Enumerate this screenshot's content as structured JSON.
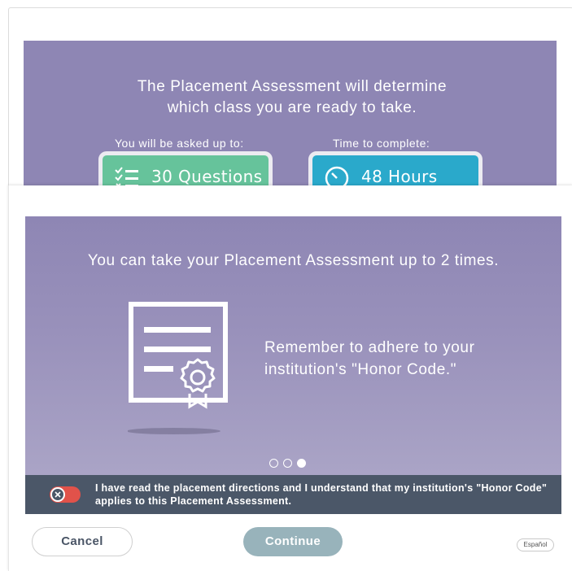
{
  "previous_slide": {
    "title": "The Placement Assessment will determine which class you are ready to take.",
    "asked_label": "You will be asked up to:",
    "time_label": "Time to complete:",
    "questions_value": "30 Questions",
    "hours_value": "48 Hours",
    "icons": [
      "checklist-icon",
      "clock-icon"
    ],
    "colors": {
      "questions": "#66c39b",
      "hours": "#2aa9cb"
    }
  },
  "slide": {
    "heading": "You can take your Placement Assessment up to 2 times.",
    "honor_text": "Remember to adhere to your institution's \"Honor Code.\"",
    "icon": "certificate-icon",
    "pagination": {
      "total": 3,
      "active": 3
    }
  },
  "agreement": {
    "text": "I have read the placement directions and I understand that my institution's \"Honor Code\" applies to this Placement Assessment.",
    "checked": false
  },
  "footer": {
    "cancel_label": "Cancel",
    "continue_label": "Continue",
    "language_label": "Español"
  },
  "colors": {
    "panel": "#8e86b4",
    "agree_bar": "#4b5768",
    "toggle_off": "#e1524a",
    "continue_disabled": "#98b3bb"
  }
}
